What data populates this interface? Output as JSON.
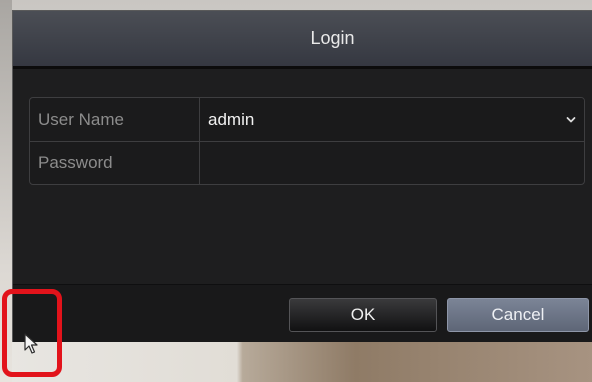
{
  "dialog": {
    "title": "Login",
    "fields": [
      {
        "label": "User Name",
        "value": "admin"
      },
      {
        "label": "Password",
        "value": ""
      }
    ],
    "buttons": {
      "ok": "OK",
      "cancel": "Cancel"
    }
  },
  "colors": {
    "dialog_bg": "#1e1e1f",
    "titlebar": "#3f424a",
    "cancel_button": "#6a7385",
    "highlight": "#e2131b"
  },
  "icons": {
    "dropdown": "chevron-down-icon",
    "cursor": "mouse-pointer-icon"
  }
}
